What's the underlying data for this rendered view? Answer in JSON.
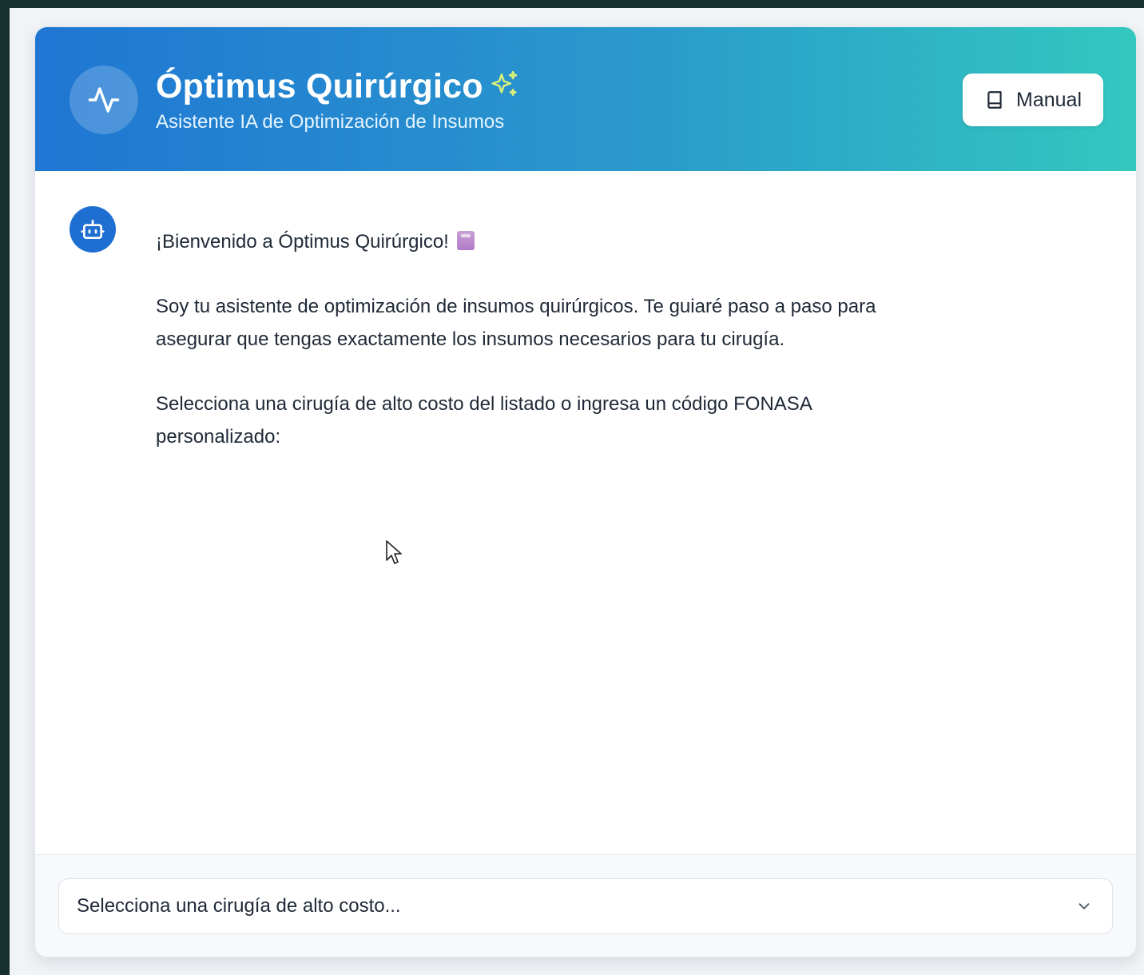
{
  "header": {
    "title": "Óptimus Quirúrgico",
    "subtitle": "Asistente IA de Optimización de Insumos",
    "manual_label": "Manual",
    "logo_icon": "activity-pulse-icon",
    "sparkle_icon": "sparkles-icon",
    "manual_icon": "book-icon"
  },
  "chat": {
    "avatar_icon": "bot-icon",
    "messages": [
      {
        "greeting": "¡Bienvenido a Óptimus Quirúrgico!",
        "paragraph1": "Soy tu asistente de optimización de insumos quirúrgicos. Te guiaré paso a paso para asegurar que tengas exactamente los insumos necesarios para tu cirugía.",
        "paragraph2": "Selecciona una cirugía de alto costo del listado o ingresa un código FONASA personalizado:"
      }
    ]
  },
  "footer": {
    "select_value": "Selecciona una cirugía de alto costo...",
    "select_icon": "chevron-down-icon"
  },
  "colors": {
    "header_gradient_start": "#1f76d3",
    "header_gradient_end": "#32c8bf",
    "avatar_bg": "#1e6fd1",
    "sparkle": "#d8f07a"
  }
}
